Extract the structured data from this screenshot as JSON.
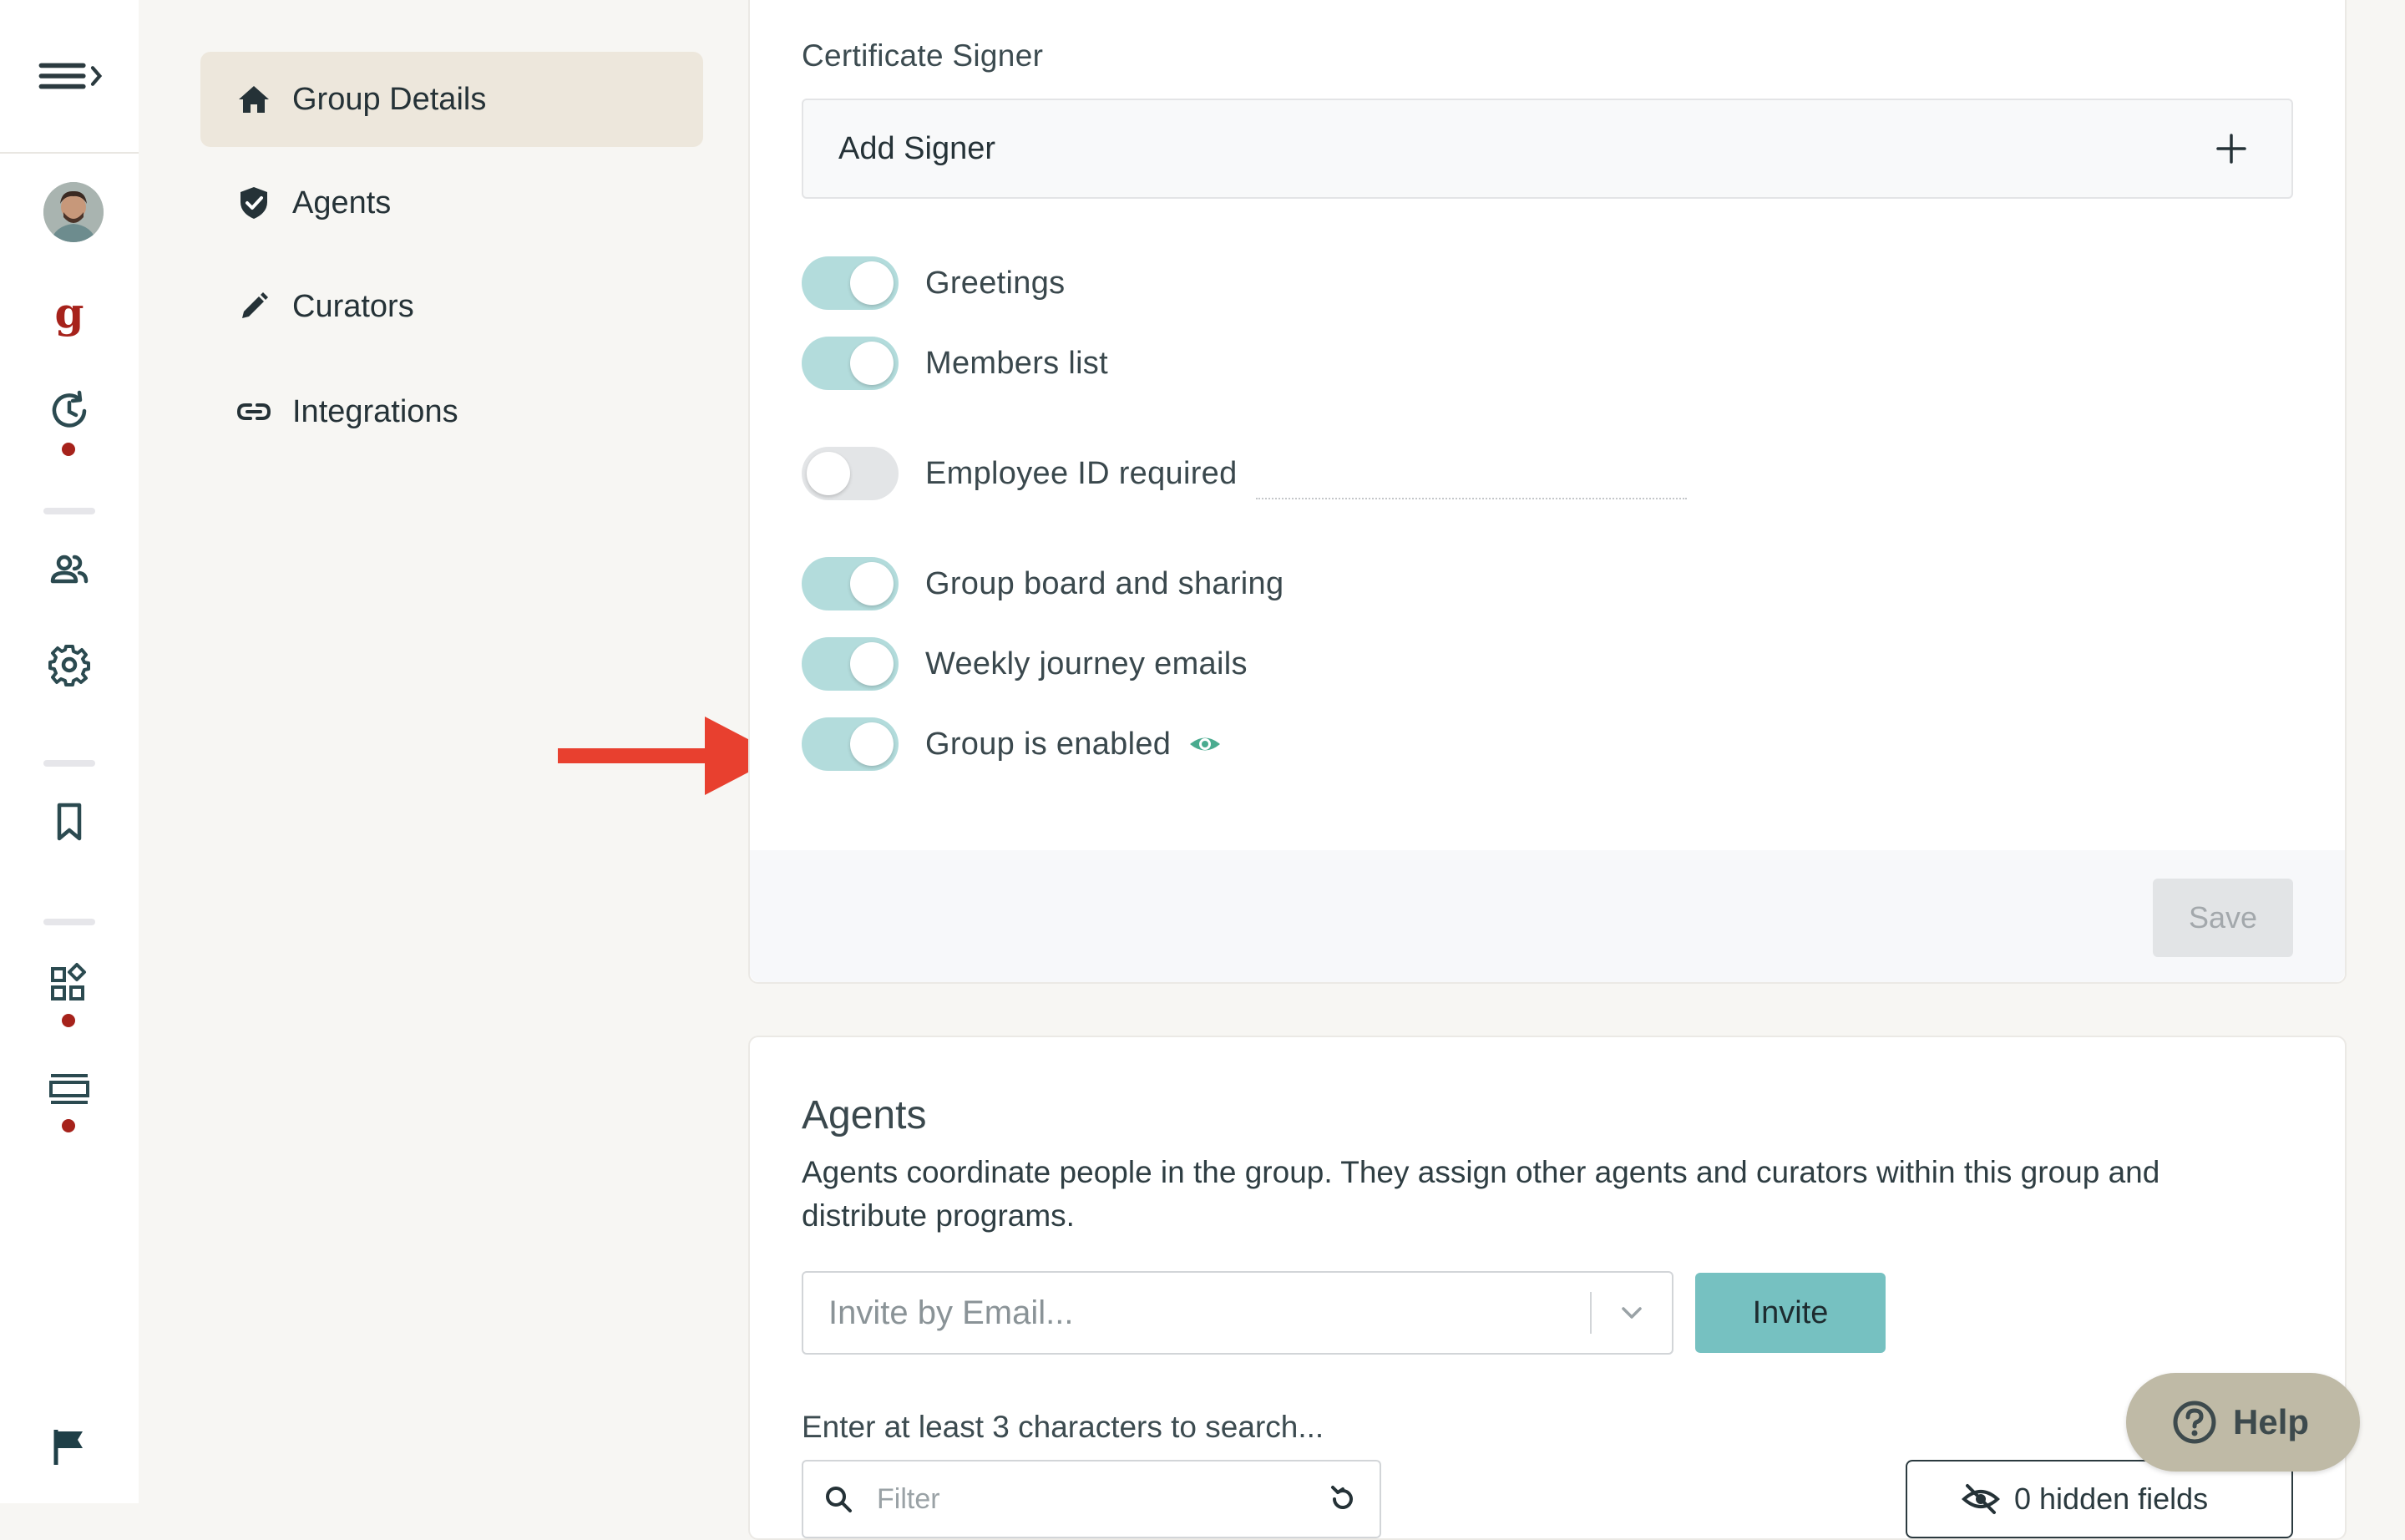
{
  "colors": {
    "accent_teal": "#76c1c1",
    "toggle_on": "#b3dcdc",
    "brand_red": "#a6221b",
    "active_nav": "#ede7dc",
    "arrow": "#e8402f"
  },
  "rail": {
    "icons": [
      "menu-expand-icon",
      "avatar",
      "logo-g-icon",
      "history-icon",
      "people-icon",
      "settings-gear-icon",
      "bookmark-icon",
      "apps-icon",
      "list-icon",
      "flag-icon"
    ]
  },
  "subnav": {
    "items": [
      {
        "label": "Group Details",
        "icon": "home-icon",
        "active": true
      },
      {
        "label": "Agents",
        "icon": "shield-check-icon"
      },
      {
        "label": "Curators",
        "icon": "pencil-icon"
      },
      {
        "label": "Integrations",
        "icon": "link-icon"
      }
    ]
  },
  "settings": {
    "certificate_label": "Certificate Signer",
    "add_signer": "Add Signer",
    "toggles": [
      {
        "label": "Greetings",
        "on": true
      },
      {
        "label": "Members list",
        "on": true
      },
      {
        "label": "Employee ID required",
        "on": false
      },
      {
        "label": "Group board and sharing",
        "on": true
      },
      {
        "label": "Weekly journey emails",
        "on": true
      },
      {
        "label": "Group is enabled",
        "on": true
      }
    ],
    "save_label": "Save"
  },
  "agents": {
    "title": "Agents",
    "description": "Agents coordinate people in the group. They assign other agents and curators within this group and distribute programs.",
    "invite_placeholder": "Invite by Email...",
    "invite_label": "Invite",
    "search_hint": "Enter at least 3 characters to search...",
    "filter_placeholder": "Filter",
    "hidden_fields_label": "0 hidden fields"
  },
  "help": {
    "label": "Help"
  }
}
